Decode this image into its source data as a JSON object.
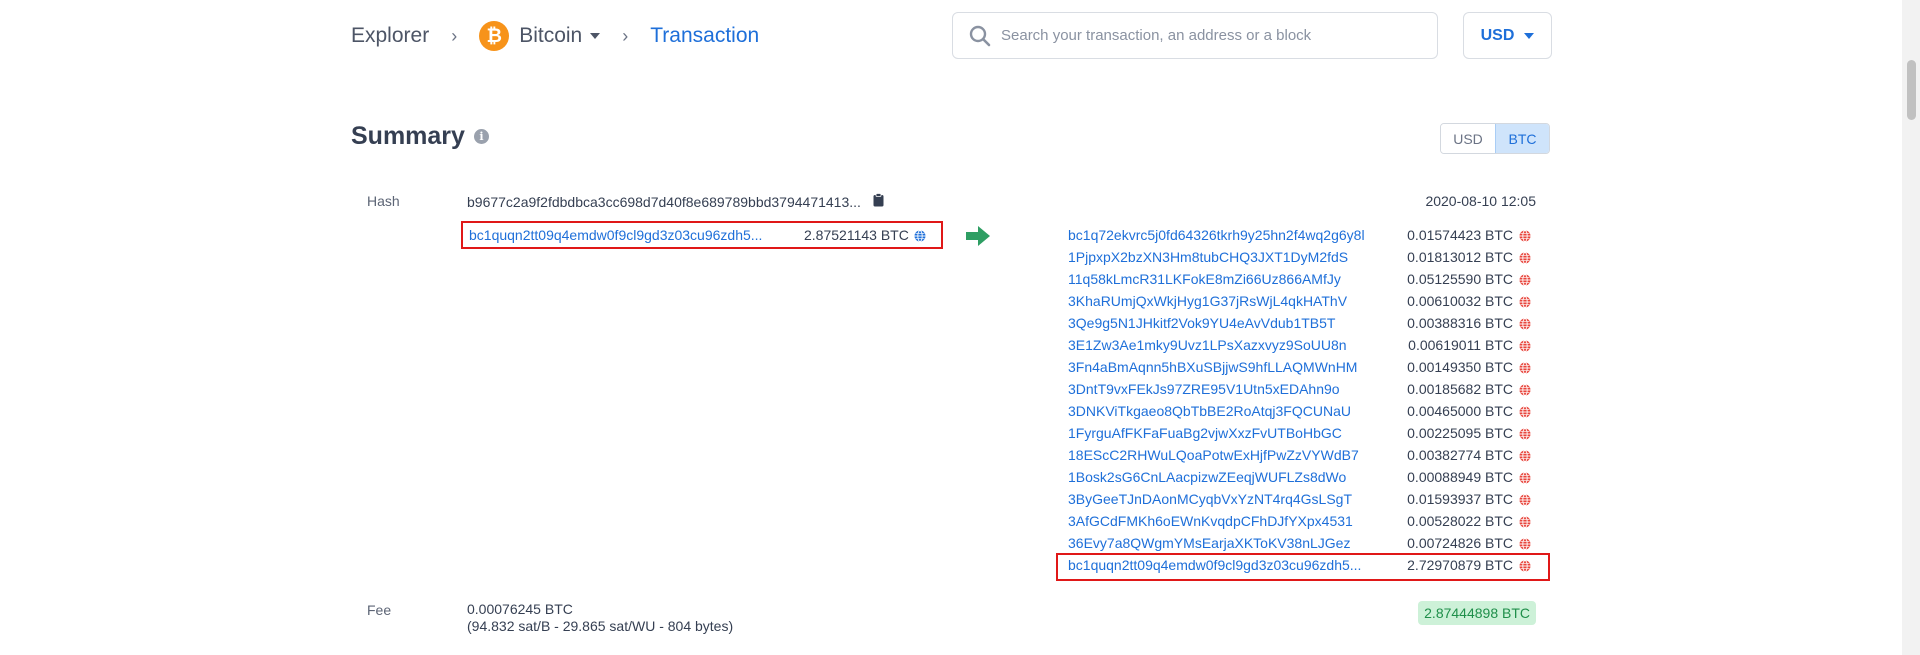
{
  "breadcrumb": {
    "explorer": "Explorer",
    "coin": "Bitcoin",
    "page": "Transaction",
    "sep": "›"
  },
  "search": {
    "placeholder": "Search your transaction, an address or a block"
  },
  "currency": {
    "selected": "USD"
  },
  "summary": {
    "title": "Summary",
    "info_glyph": "i",
    "units": [
      "USD",
      "BTC"
    ],
    "active_unit": "BTC"
  },
  "labels": {
    "hash": "Hash",
    "fee": "Fee"
  },
  "tx": {
    "hash": "b9677c2a9f2fdbdbca3cc698d7d40f8e689789bbd3794471413...",
    "timestamp": "2020-08-10 12:05",
    "input": {
      "address": "bc1quqn2tt09q4emdw0f9cl9gd3z03cu96zdh5...",
      "amount": "2.87521143 BTC"
    },
    "outputs": [
      {
        "address": "bc1q72ekvrc5j0fd64326tkrh9y25hn2f4wq2g6y8l",
        "amount": "0.01574423 BTC"
      },
      {
        "address": "1PjpxpX2bzXN3Hm8tubCHQ3JXT1DyM2fdS",
        "amount": "0.01813012 BTC"
      },
      {
        "address": "11q58kLmcR31LKFokE8mZi66Uz866AMfJy",
        "amount": "0.05125590 BTC"
      },
      {
        "address": "3KhaRUmjQxWkjHyg1G37jRsWjL4qkHAThV",
        "amount": "0.00610032 BTC"
      },
      {
        "address": "3Qe9g5N1JHkitf2Vok9YU4eAvVdub1TB5T",
        "amount": "0.00388316 BTC"
      },
      {
        "address": "3E1Zw3Ae1mky9Uvz1LPsXazxvyz9SoUU8n",
        "amount": "0.00619011 BTC"
      },
      {
        "address": "3Fn4aBmAqnn5hBXuSBjjwS9hfLLAQMWnHM",
        "amount": "0.00149350 BTC"
      },
      {
        "address": "3DntT9vxFEkJs97ZRE95V1Utn5xEDAhn9o",
        "amount": "0.00185682 BTC"
      },
      {
        "address": "3DNKViTkgaeo8QbTbBE2RoAtqj3FQCUNaU",
        "amount": "0.00465000 BTC"
      },
      {
        "address": "1FyrguAfFKFaFuaBg2vjwXxzFvUTBoHbGC",
        "amount": "0.00225095 BTC"
      },
      {
        "address": "18EScC2RHWuLQoaPotwExHjfPwZzVYWdB7",
        "amount": "0.00382774 BTC"
      },
      {
        "address": "1Bosk2sG6CnLAacpizwZEeqjWUFLZs8dWo",
        "amount": "0.00088949 BTC"
      },
      {
        "address": "3ByGeeTJnDAonMCyqbVxYzNT4rq4GsLSgT",
        "amount": "0.01593937 BTC"
      },
      {
        "address": "3AfGCdFMKh6oEWnKvqdpCFhDJfYXpx4531",
        "amount": "0.00528022 BTC"
      },
      {
        "address": "36Evy7a8QWgmYMsEarjaXKToKV38nLJGez",
        "amount": "0.00724826 BTC"
      },
      {
        "address": "bc1quqn2tt09q4emdw0f9cl9gd3z03cu96zdh5...",
        "amount": "2.72970879 BTC"
      }
    ],
    "fee": "0.00076245 BTC",
    "fee_detail": "(94.832 sat/B - 29.865 sat/WU - 804 bytes)",
    "total": "2.87444898 BTC"
  },
  "colors": {
    "link": "#1e6fd9",
    "bitcoin": "#f7931a",
    "highlight_border": "#e01818",
    "arrow": "#2e9e63",
    "total_bg": "#cdf1d8"
  },
  "icons": {
    "btc": "bitcoin-logo-icon",
    "search": "search-icon",
    "clipboard": "clipboard-icon",
    "globe_input": "globe-icon",
    "globe_output": "globe-icon",
    "arrow": "arrow-right-icon"
  }
}
